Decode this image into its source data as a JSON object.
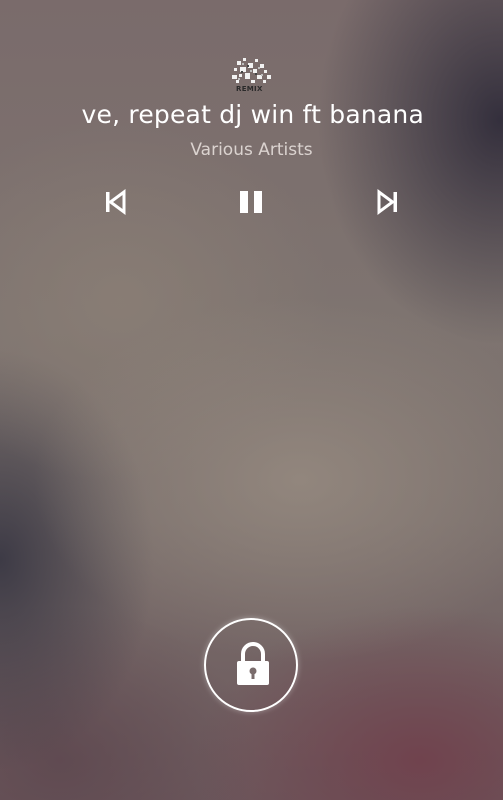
{
  "now_playing": {
    "album_art_label": "REMIX",
    "title": "ve, repeat dj win ft banana",
    "artist": "Various Artists"
  },
  "controls": {
    "previous_icon": "skip-previous-icon",
    "pause_icon": "pause-icon",
    "next_icon": "skip-next-icon"
  },
  "lock": {
    "icon": "lock-icon"
  },
  "colors": {
    "foreground": "#ffffff",
    "artist_text": "#ebe4e1"
  }
}
